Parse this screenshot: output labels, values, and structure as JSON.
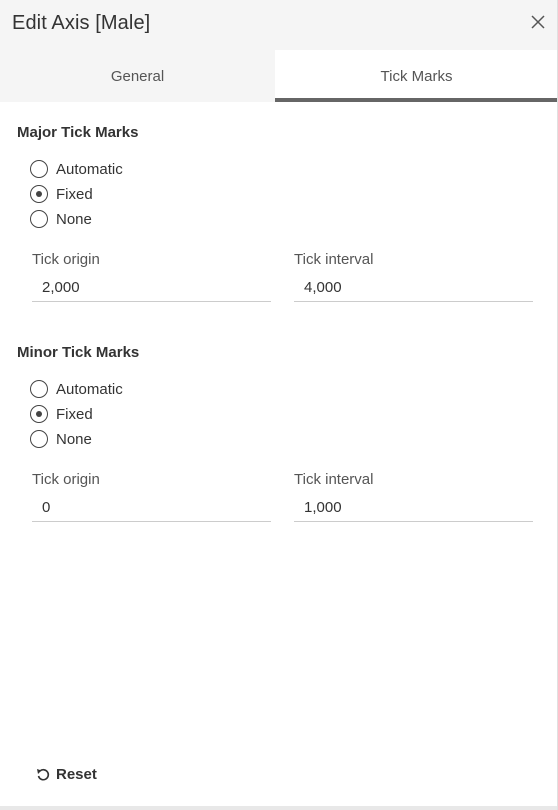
{
  "dialog": {
    "title": "Edit Axis [Male]",
    "close_icon": "close-icon"
  },
  "tabs": [
    {
      "label": "General",
      "selected": false
    },
    {
      "label": "Tick Marks",
      "selected": true
    }
  ],
  "major": {
    "title": "Major Tick Marks",
    "options": [
      {
        "label": "Automatic",
        "checked": false
      },
      {
        "label": "Fixed",
        "checked": true
      },
      {
        "label": "None",
        "checked": false
      }
    ],
    "origin_label": "Tick origin",
    "origin_value": "2,000",
    "interval_label": "Tick interval",
    "interval_value": "4,000"
  },
  "minor": {
    "title": "Minor Tick Marks",
    "options": [
      {
        "label": "Automatic",
        "checked": false
      },
      {
        "label": "Fixed",
        "checked": true
      },
      {
        "label": "None",
        "checked": false
      }
    ],
    "origin_label": "Tick origin",
    "origin_value": "0",
    "interval_label": "Tick interval",
    "interval_value": "1,000"
  },
  "footer": {
    "reset_label": "Reset",
    "reset_icon": "undo-icon"
  },
  "colors": {
    "tab_underline": "#666666",
    "header_bg": "#f5f5f5",
    "text": "#333333"
  }
}
